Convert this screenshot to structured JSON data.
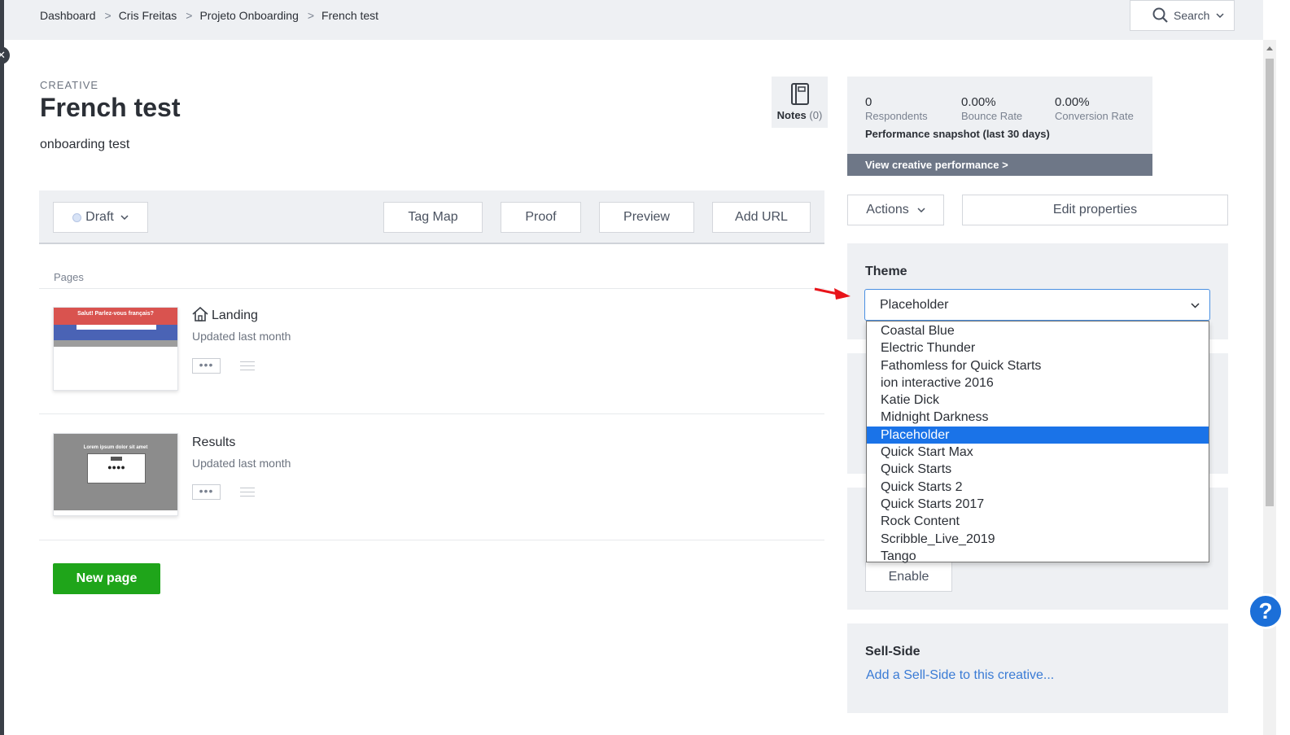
{
  "breadcrumb": {
    "items": [
      "Dashboard",
      "Cris Freitas",
      "Projeto Onboarding",
      "French test"
    ],
    "separator": ">"
  },
  "search": {
    "label": "Search"
  },
  "header": {
    "eyebrow": "CREATIVE",
    "title": "French test",
    "subtitle": "onboarding test"
  },
  "notes": {
    "label": "Notes",
    "count": "(0)"
  },
  "toolbar": {
    "status_label": "Draft",
    "tag_map_label": "Tag Map",
    "proof_label": "Proof",
    "preview_label": "Preview",
    "add_url_label": "Add URL"
  },
  "pages": {
    "label": "Pages",
    "items": [
      {
        "name": "Landing",
        "updated": "Updated last month",
        "more_label": "•••",
        "thumb_header": "Salut! Parlez-vous français?",
        "is_home": true
      },
      {
        "name": "Results",
        "updated": "Updated last month",
        "more_label": "•••",
        "thumb_header": "Lorem ipsum dolor sit amet",
        "is_home": false
      }
    ],
    "new_page_label": "New page"
  },
  "performance": {
    "metrics": [
      {
        "value": "0",
        "label": "Respondents"
      },
      {
        "value": "0.00%",
        "label": "Bounce Rate"
      },
      {
        "value": "0.00%",
        "label": "Conversion Rate"
      }
    ],
    "title": "Performance snapshot (last 30 days)",
    "link_label": "View creative performance >"
  },
  "sidebar_actions": {
    "actions_label": "Actions",
    "edit_properties_label": "Edit properties"
  },
  "theme": {
    "title": "Theme",
    "selected": "Placeholder",
    "options": [
      "Coastal Blue",
      "Electric Thunder",
      "Fathomless for Quick Starts",
      "ion interactive 2016",
      "Katie Dick",
      "Midnight Darkness",
      "Placeholder",
      "Quick Start Max",
      "Quick Starts",
      "Quick Starts 2",
      "Quick Starts 2017",
      "Rock Content",
      "Scribble_Live_2019",
      "Tango"
    ],
    "highlighted_index": 6
  },
  "enable_label": "Enable",
  "sell_side": {
    "title": "Sell-Side",
    "link_label": "Add a Sell-Side to this creative..."
  },
  "help_label": "?",
  "colors": {
    "accent_green": "#1fa51a",
    "link_blue": "#3a7bd5",
    "selection_blue": "#1a73e8",
    "annotation_red": "#e8141a"
  }
}
